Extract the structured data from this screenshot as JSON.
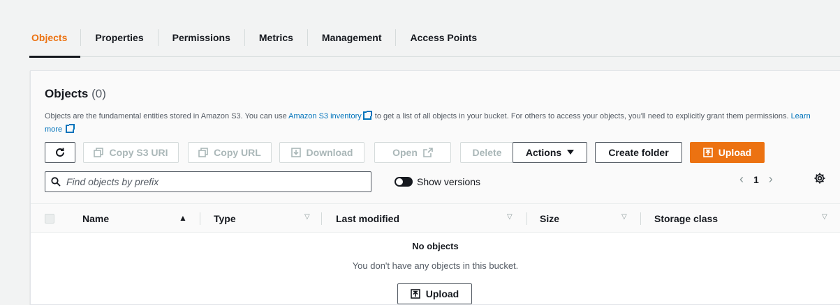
{
  "tabs": [
    {
      "label": "Objects",
      "active": true
    },
    {
      "label": "Properties"
    },
    {
      "label": "Permissions"
    },
    {
      "label": "Metrics"
    },
    {
      "label": "Management"
    },
    {
      "label": "Access Points"
    }
  ],
  "panel": {
    "title": "Objects",
    "count": "(0)",
    "desc_part1": "Objects are the fundamental entities stored in Amazon S3. You can use ",
    "desc_link1": "Amazon S3 inventory",
    "desc_part2": " to get a list of all objects in your bucket. For others to access your objects, you'll need to explicitly grant them permissions. ",
    "desc_link2": "Learn more"
  },
  "toolbar": {
    "refresh_icon": "refresh-icon",
    "copy_s3_uri": "Copy S3 URI",
    "copy_url": "Copy URL",
    "download": "Download",
    "open": "Open",
    "delete": "Delete",
    "actions": "Actions",
    "create_folder": "Create folder",
    "upload": "Upload"
  },
  "search": {
    "placeholder": "Find objects by prefix"
  },
  "versions_toggle": {
    "label": "Show versions",
    "on": false
  },
  "pagination": {
    "page": "1"
  },
  "table": {
    "columns": [
      "Name",
      "Type",
      "Last modified",
      "Size",
      "Storage class"
    ]
  },
  "empty_state": {
    "title": "No objects",
    "message": "You don't have any objects in this bucket.",
    "button": "Upload"
  },
  "colors": {
    "accent": "#ec7211",
    "link": "#0073bb",
    "text": "#16191f",
    "muted": "#545b64"
  }
}
